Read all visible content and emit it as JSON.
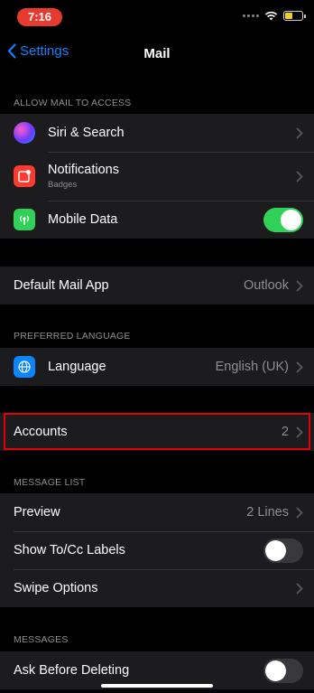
{
  "status": {
    "time": "7:16",
    "battery_level": 0.45
  },
  "nav": {
    "back_label": "Settings",
    "title": "Mail"
  },
  "sections": {
    "allow_access": "ALLOW MAIL TO ACCESS",
    "preferred_language": "PREFERRED LANGUAGE",
    "message_list": "MESSAGE LIST",
    "messages": "MESSAGES"
  },
  "rows": {
    "siri": {
      "label": "Siri & Search",
      "icon": "siri-icon"
    },
    "notifications": {
      "label": "Notifications",
      "sublabel": "Badges",
      "icon": "notifications-icon",
      "icon_color": "#ff3b30"
    },
    "mobile_data": {
      "label": "Mobile Data",
      "icon": "antenna-icon",
      "icon_color": "#30d158",
      "toggle": true
    },
    "default_mail": {
      "label": "Default Mail App",
      "value": "Outlook"
    },
    "language": {
      "label": "Language",
      "value": "English (UK)",
      "icon": "globe-icon",
      "icon_color": "#0a84ff"
    },
    "accounts": {
      "label": "Accounts",
      "value": "2"
    },
    "preview": {
      "label": "Preview",
      "value": "2 Lines"
    },
    "show_tocc": {
      "label": "Show To/Cc Labels",
      "toggle": false
    },
    "swipe": {
      "label": "Swipe Options"
    },
    "ask_delete": {
      "label": "Ask Before Deleting",
      "toggle": false
    }
  },
  "colors": {
    "accent": "#0a84ff",
    "toggle_on": "#30d158",
    "highlight": "#e3000b"
  }
}
